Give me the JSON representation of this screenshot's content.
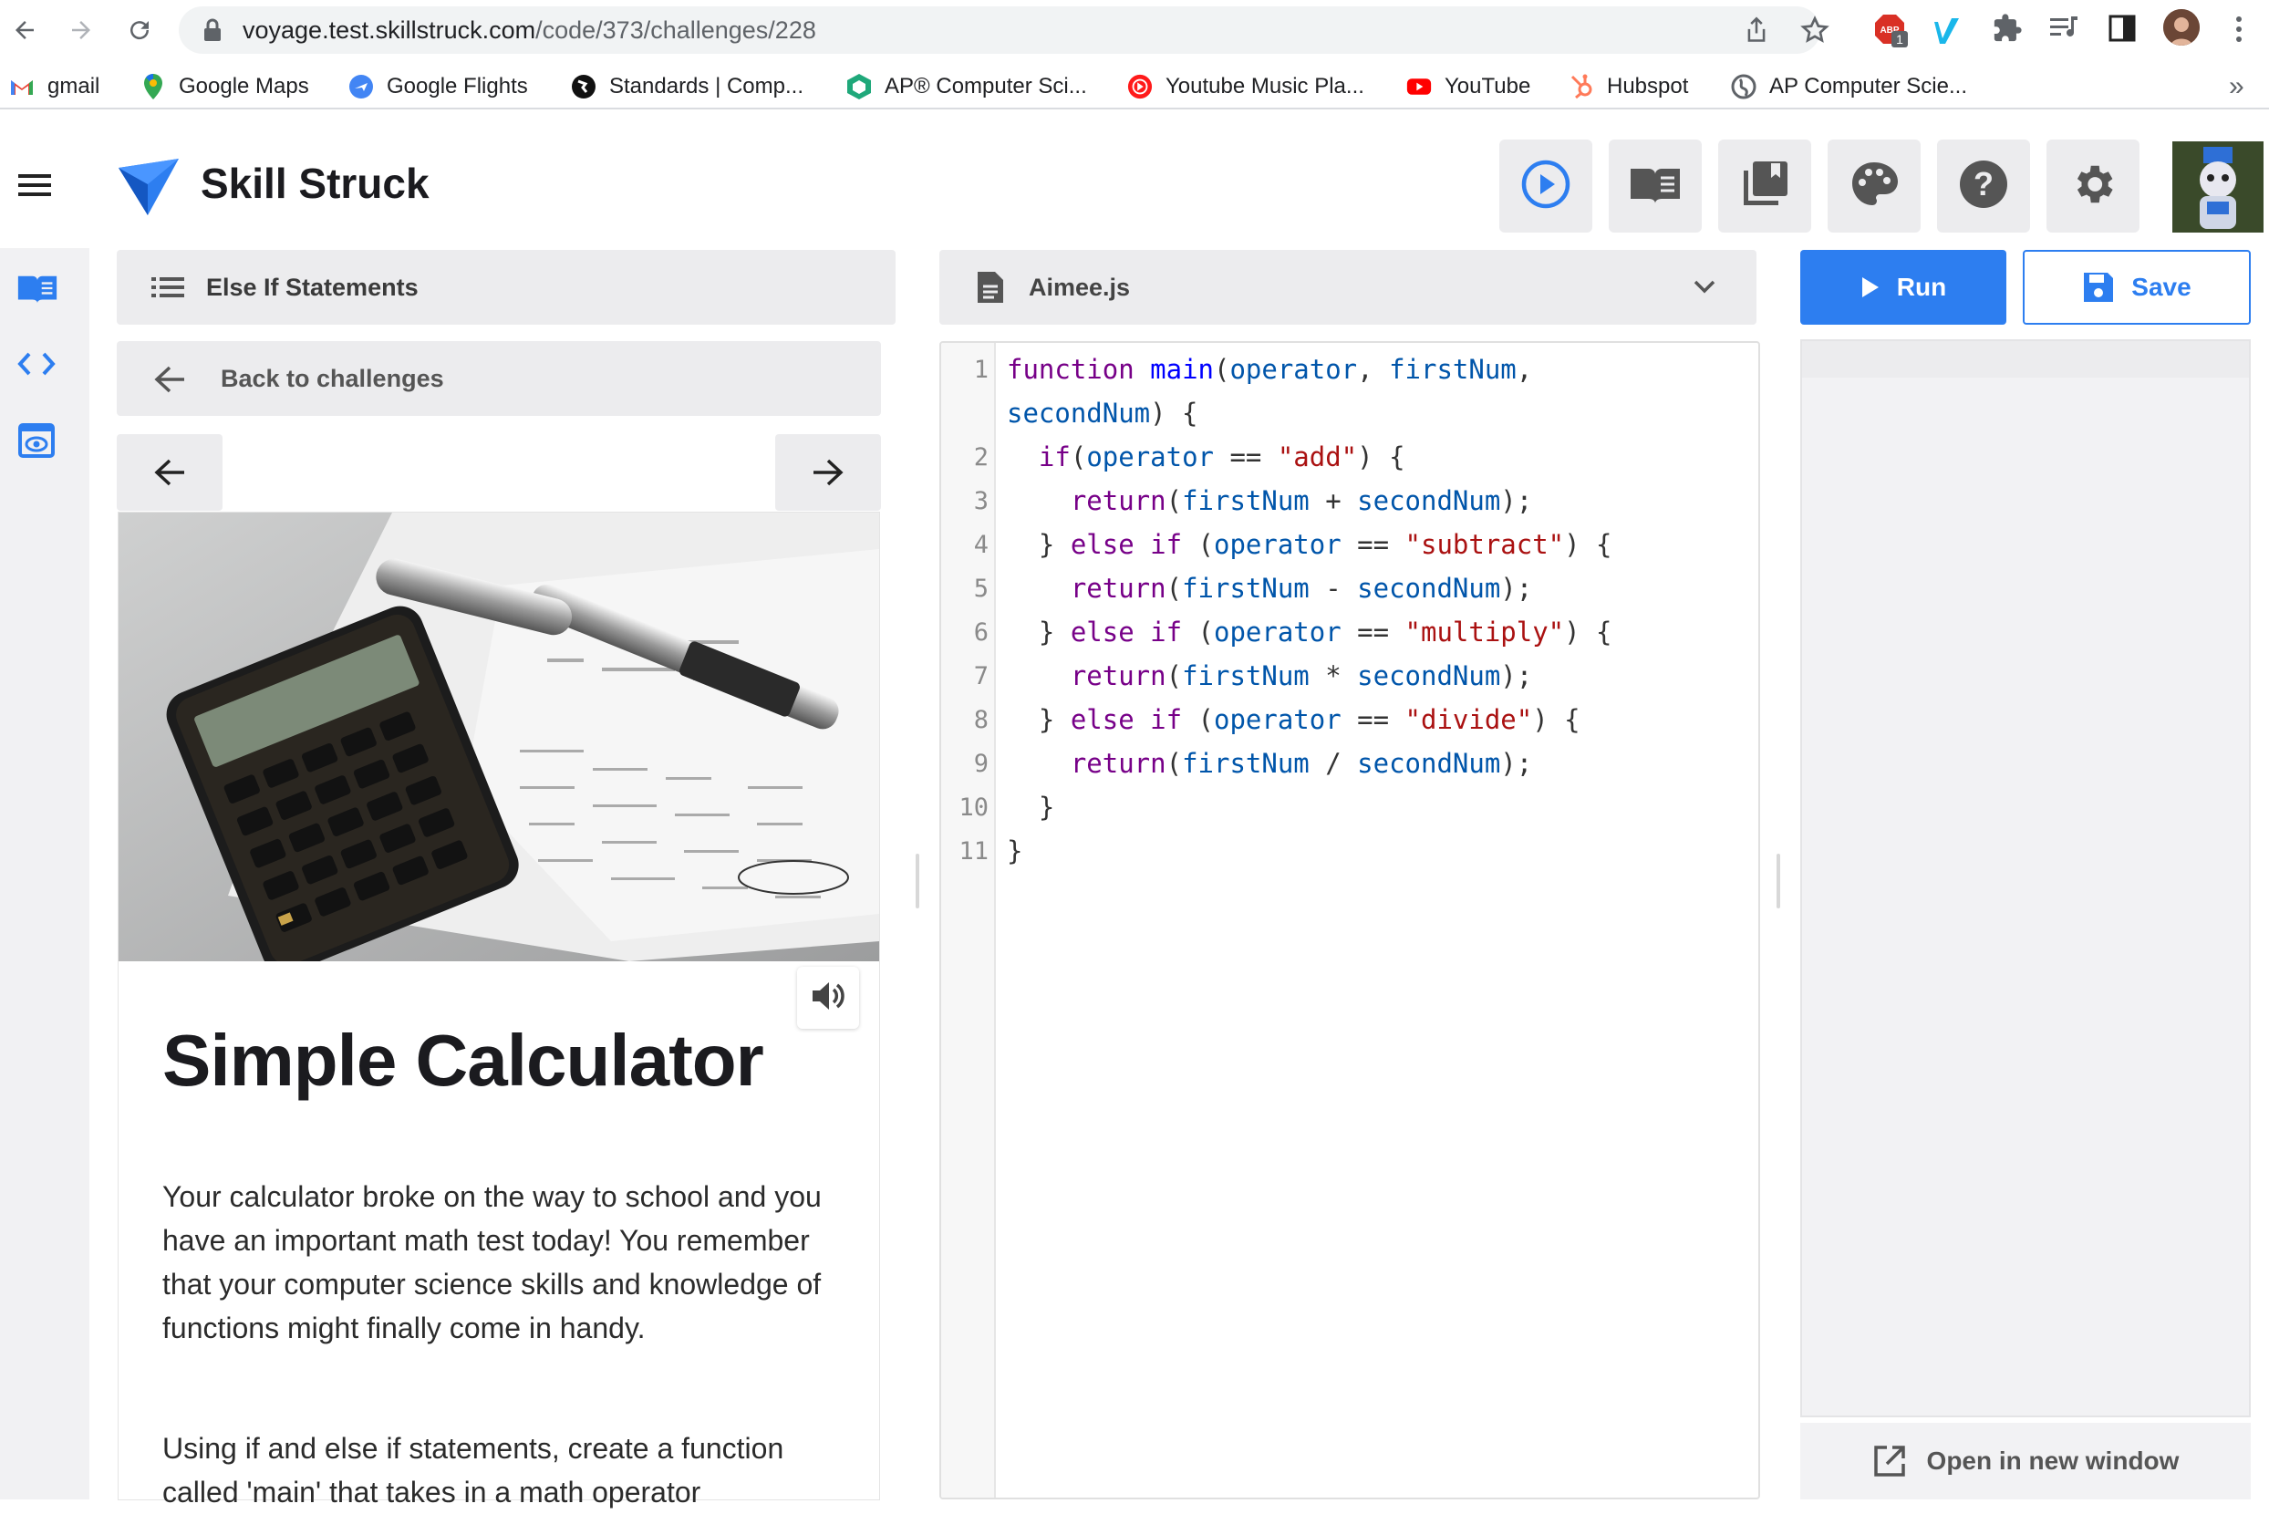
{
  "browser": {
    "url_host": "voyage.test.skillstruck.com",
    "url_path": "/code/373/challenges/228",
    "adblock_count": "1",
    "bookmarks": [
      {
        "label": "gmail",
        "icon": "gmail-icon"
      },
      {
        "label": "Google Maps",
        "icon": "maps-pin-icon"
      },
      {
        "label": "Google Flights",
        "icon": "plane-icon"
      },
      {
        "label": "Standards | Comp...",
        "icon": "globe-dark-icon"
      },
      {
        "label": "AP® Computer Sci...",
        "icon": "hexagon-icon"
      },
      {
        "label": "Youtube Music Pla...",
        "icon": "music-play-icon"
      },
      {
        "label": "YouTube",
        "icon": "youtube-icon"
      },
      {
        "label": "Hubspot",
        "icon": "hubspot-icon"
      },
      {
        "label": "AP Computer Scie...",
        "icon": "globe-icon"
      }
    ],
    "more_bookmarks": "»"
  },
  "app": {
    "brand": "Skill Struck",
    "accent_color": "#2d7ef0",
    "toolbar_icons": [
      "play-circle-icon",
      "book-icon",
      "library-icon",
      "palette-icon",
      "help-icon",
      "settings-icon",
      "avatar"
    ]
  },
  "lesson": {
    "section": "Else If Statements",
    "back_label": "Back to challenges",
    "title": "Simple Calculator",
    "paragraph1": "Your calculator broke on the way to school and you have an important math test today! You remember that your computer science skills and knowledge of functions might finally come in handy.",
    "paragraph2": "Using if and else if statements, create a function called 'main' that takes in a math operator"
  },
  "editor": {
    "filename": "Aimee.js",
    "line_numbers": [
      "1",
      "2",
      "3",
      "4",
      "5",
      "6",
      "7",
      "8",
      "9",
      "10",
      "11"
    ]
  },
  "actions": {
    "run": "Run",
    "save": "Save",
    "open_new_window": "Open in new window"
  }
}
